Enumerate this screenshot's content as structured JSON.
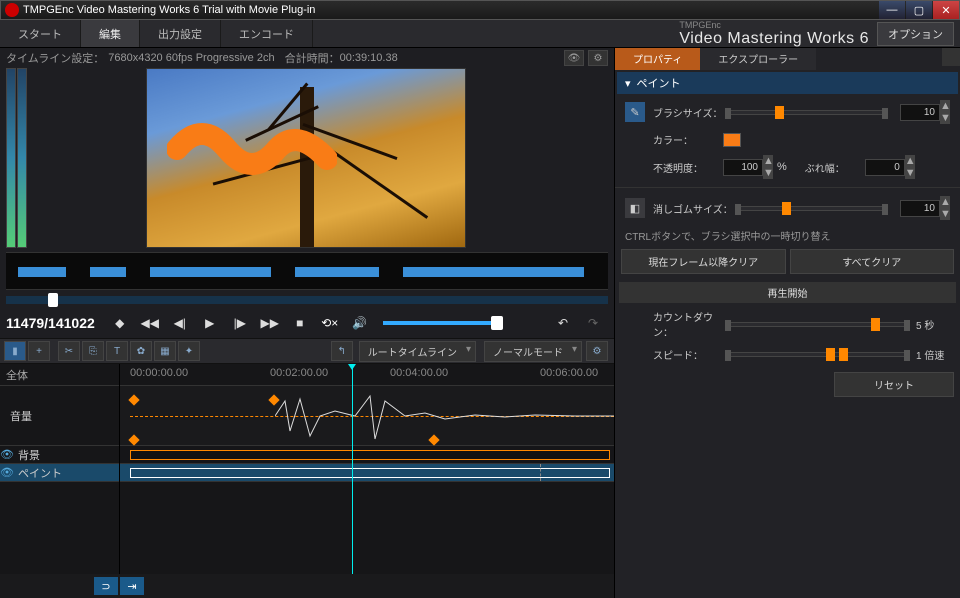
{
  "window": {
    "title": "TMPGEnc Video Mastering Works 6 Trial with Movie Plug-in"
  },
  "brand": {
    "small": "TMPGEnc",
    "big": "Video Mastering Works 6"
  },
  "top": {
    "start": "スタート",
    "edit": "編集",
    "output": "出力設定",
    "encode": "エンコード",
    "option": "オプション"
  },
  "info": {
    "tl_label": "タイムライン設定：",
    "tl_fmt": "7680x4320 60fps Progressive 2ch",
    "total_label": "合計時間：",
    "total_time": "00:39:10.38"
  },
  "transport": {
    "frames": "11479/141022"
  },
  "toolrow": {
    "root_tl": "ルートタイムライン",
    "normal": "ノーマルモード"
  },
  "ruler": {
    "t0": "00:00:00.00",
    "t2": "00:02:00.00",
    "t4": "00:04:00.00",
    "t6": "00:06:00.00"
  },
  "tracks": {
    "all": "全体",
    "vol": "音量",
    "bg": "背景",
    "paint": "ペイント"
  },
  "rtabs": {
    "prop": "プロパティ",
    "exp": "エクスプローラー"
  },
  "panel": {
    "section": "ペイント",
    "brush_size": "ブラシサイズ：",
    "color": "カラー：",
    "opacity": "不透明度：",
    "blur": "ぶれ幅：",
    "eraser_size": "消しゴムサイズ：",
    "brush_val": "10",
    "opacity_val": "100",
    "blur_val": "0",
    "eraser_val": "10",
    "pct": "%",
    "hint": "CTRLボタンで、ブラシ選択中の一時切り替え",
    "clear_after": "現在フレーム以降クリア",
    "clear_all": "すべてクリア",
    "play_section": "再生開始",
    "countdown": "カウントダウン：",
    "speed": "スピード：",
    "cd_suf": "5 秒",
    "sp_suf": "1 倍速",
    "reset": "リセット",
    "color_hex": "#f97c16"
  }
}
